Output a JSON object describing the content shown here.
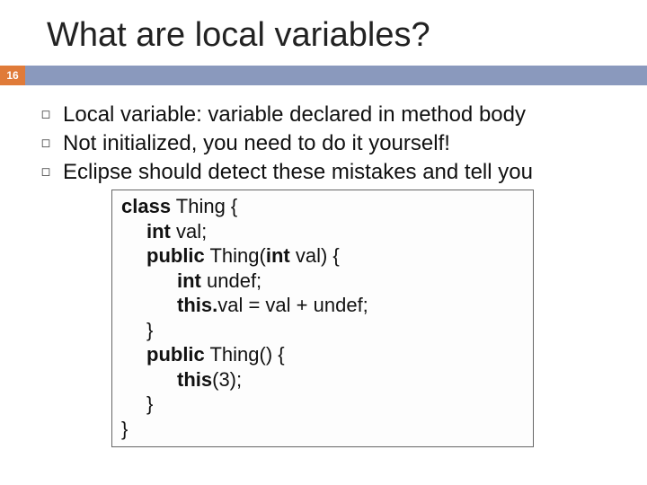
{
  "title": "What are local variables?",
  "page_number": "16",
  "bullets": [
    "Local variable: variable declared in method body",
    "Not initialized, you need to do it yourself!",
    "Eclipse should detect these mistakes and tell you"
  ],
  "code": {
    "l1a": "class",
    "l1b": " Thing {",
    "l2a": "int",
    "l2b": " val;",
    "l3a": "public",
    "l3b": " Thing(",
    "l3c": "int",
    "l3d": " val) {",
    "l4a": "int",
    "l4b": " undef;",
    "l5a": "this.",
    "l5b": "val = val + undef;",
    "l6": "}",
    "l7a": "public",
    "l7b": " Thing() {",
    "l8a": "this",
    "l8b": "(3);",
    "l9": "}",
    "l10": "}"
  }
}
